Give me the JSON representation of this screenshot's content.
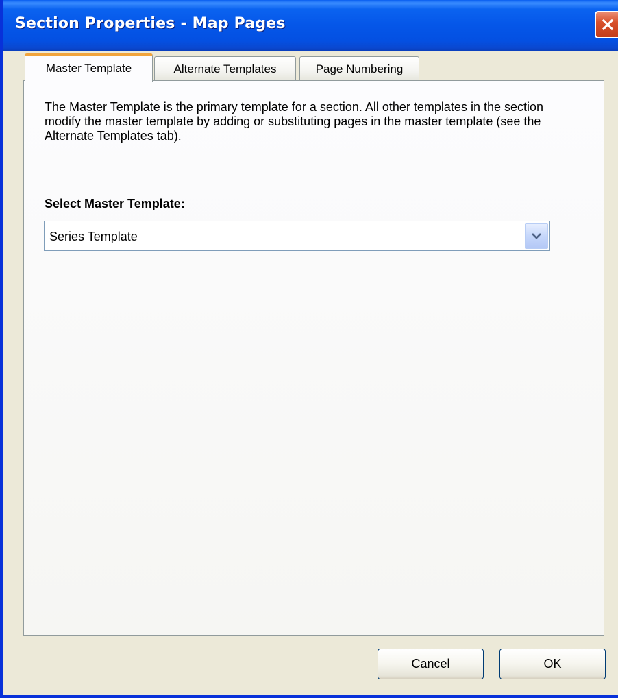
{
  "window": {
    "title": "Section Properties - Map Pages"
  },
  "tabs": [
    {
      "label": "Master Template",
      "active": true
    },
    {
      "label": "Alternate Templates",
      "active": false
    },
    {
      "label": "Page Numbering",
      "active": false
    }
  ],
  "master_tab": {
    "description": "The Master Template is the primary template for a section.  All other templates in the section modify the master template by adding or substituting pages in the master template (see the Alternate Templates tab).",
    "select_label": "Select Master Template:",
    "selected_template": "Series Template"
  },
  "buttons": {
    "cancel": "Cancel",
    "ok": "OK"
  },
  "icons": {
    "close": "close-icon",
    "dropdown": "chevron-down-icon"
  },
  "colors": {
    "titlebar": "#0556e8",
    "close_button": "#d8512c",
    "active_tab_accent": "#f1a43c",
    "window_bg": "#ece9d8"
  }
}
